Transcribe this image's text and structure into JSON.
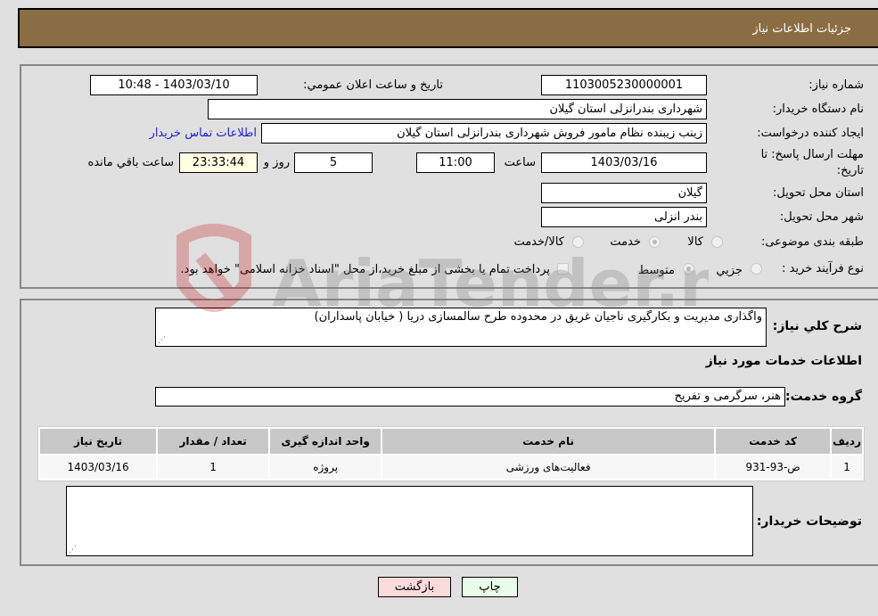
{
  "header": {
    "title": "جزئیات اطلاعات نیاز"
  },
  "form": {
    "need_number_label": "شماره نیاز:",
    "need_number": "1103005230000001",
    "announce_label": "تاریخ و ساعت اعلان عمومي:",
    "announce_value": "1403/03/10 - 10:48",
    "buyer_org_label": "نام دستگاه خریدار:",
    "buyer_org": "شهرداری بندرانزلی استان گیلان",
    "creator_label": "ایجاد کننده درخواست:",
    "creator": "زینب زیبنده نظام مامور فروش شهرداری بندرانزلی استان گیلان",
    "contact_link": "اطلاعات تماس خریدار",
    "deadline_label_line1": "مهلت ارسال پاسخ: تا",
    "deadline_label_line2": "تاریخ:",
    "deadline_date": "1403/03/16",
    "time_label": "ساعت",
    "deadline_time": "11:00",
    "days_value": "5",
    "days_label": "روز و",
    "remaining_time": "23:33:44",
    "remaining_label": "ساعت باقي مانده",
    "province_label": "استان محل تحویل:",
    "province": "گیلان",
    "city_label": "شهر محل تحویل:",
    "city": "بندر انزلی",
    "category_label": "طبقه بندی موضوعی:",
    "category_options": [
      "کالا",
      "خدمت",
      "کالا/خدمت"
    ],
    "category_selected": "خدمت",
    "process_label": "نوع فرآیند خرید :",
    "process_options": [
      "جزيي",
      "متوسط"
    ],
    "process_selected": "متوسط",
    "treasury_note": "پرداخت تمام یا بخشی از مبلغ خرید،از محل \"اسناد خزانه اسلامی\" خواهد بود."
  },
  "details": {
    "description_label": "شرح كلي نياز:",
    "description": "واگذاری مدیریت و بکارگیری ناجیان غریق  در محدوده طرح سالمسازی دریا ( خیابان پاسداران)",
    "services_heading": "اطلاعات خدمات مورد نیاز",
    "service_group_label": "گروه خدمت:",
    "service_group": "هنر، سرگرمی و تفریح",
    "table": {
      "headers": [
        "ردیف",
        "کد خدمت",
        "نام خدمت",
        "واحد اندازه گیری",
        "تعداد / مقدار",
        "تاریخ نیاز"
      ],
      "rows": [
        [
          "1",
          "ض-93-931",
          "فعالیت‌های ورزشی",
          "پروژه",
          "1",
          "1403/03/16"
        ]
      ]
    },
    "buyer_notes_label": "توضیحات خریدار:",
    "buyer_notes": ""
  },
  "buttons": {
    "print": "چاپ",
    "back": "بازگشت"
  },
  "watermark": {
    "text": "AriaTender.neT"
  }
}
